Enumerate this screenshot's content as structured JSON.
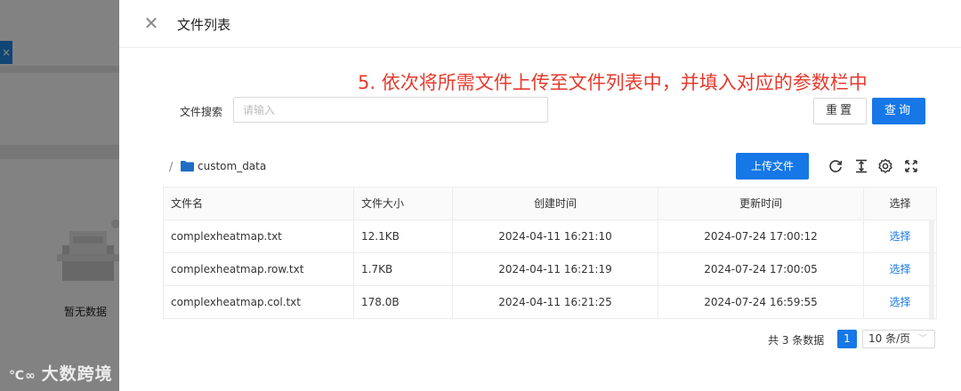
{
  "background": {
    "tab_close": "×",
    "empty_text": "暂无数据",
    "watermark": "大数跨境",
    "watermark_logo": "℃∞"
  },
  "drawer": {
    "title": "文件列表",
    "annotation": "5. 依次将所需文件上传至文件列表中，并填入对应的参数栏中"
  },
  "search": {
    "label": "文件搜索",
    "placeholder": "请输入",
    "value": "",
    "reset_label": "重置",
    "query_label": "查询"
  },
  "breadcrumb": {
    "separator": "/",
    "folder": "custom_data"
  },
  "toolbar": {
    "upload_label": "上传文件",
    "icons": [
      "refresh-icon",
      "column-height-icon",
      "settings-icon",
      "fullscreen-icon"
    ]
  },
  "table": {
    "columns": [
      "文件名",
      "文件大小",
      "创建时间",
      "更新时间",
      "选择"
    ],
    "rows": [
      {
        "name": "complexheatmap.txt",
        "size": "12.1KB",
        "created": "2024-04-11 16:21:10",
        "updated": "2024-07-24 17:00:12",
        "action": "选择"
      },
      {
        "name": "complexheatmap.row.txt",
        "size": "1.7KB",
        "created": "2024-04-11 16:21:19",
        "updated": "2024-07-24 17:00:05",
        "action": "选择"
      },
      {
        "name": "complexheatmap.col.txt",
        "size": "178.0B",
        "created": "2024-04-11 16:21:25",
        "updated": "2024-07-24 16:59:55",
        "action": "选择"
      }
    ]
  },
  "pagination": {
    "total_text": "共 3 条数据",
    "current_page": "1",
    "page_size": "10 条/页"
  },
  "colors": {
    "primary": "#1677e6",
    "annotation": "#e53a2d",
    "folder": "#1e6fc4"
  }
}
